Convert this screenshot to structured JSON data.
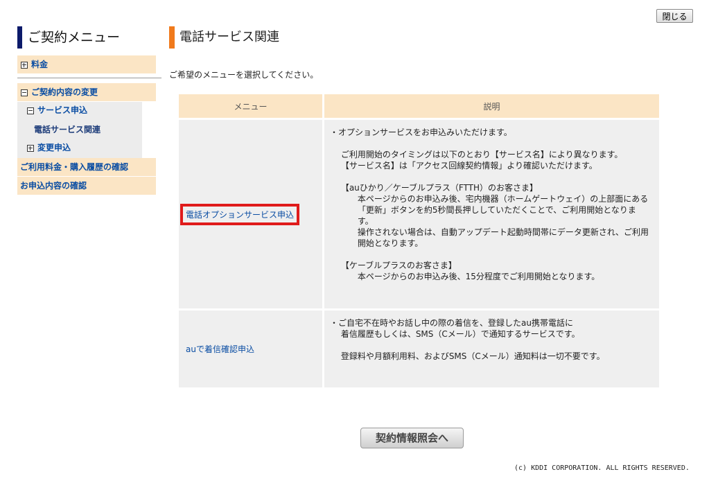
{
  "header": {
    "close_label": "閉じる"
  },
  "sidebar": {
    "title": "ご契約メニュー",
    "items": [
      {
        "label": "料金",
        "icon": "plus"
      },
      {
        "label": "ご契約内容の変更",
        "icon": "minus"
      },
      {
        "label": "サービス申込",
        "icon": "minus"
      },
      {
        "label": "電話サービス関連",
        "icon": "none"
      },
      {
        "label": "変更申込",
        "icon": "plus"
      },
      {
        "label": "ご利用料金・購入履歴の確認",
        "icon": "none"
      },
      {
        "label": "お申込内容の確認",
        "icon": "none"
      }
    ]
  },
  "main": {
    "title": "電話サービス関連",
    "instruction": "ご希望のメニューを選択してください。",
    "table": {
      "headers": [
        "メニュー",
        "説明"
      ],
      "rows": [
        {
          "menu": "電話オプションサービス申込",
          "description": "・オプションサービスをお申込みいただけます。\n\n　 ご利用開始のタイミングは以下のとおり【サービス名】により異なります。\n　 【サービス名】は「アクセス回線契約情報」より確認いただけます。\n\n　 【auひかり／ケーブルプラス（FTTH）のお客さま】\n　　　 本ページからのお申込み後、宅内機器（ホームゲートウェイ）の上部面にある\n　　　 「更新」ボタンを約5秒間長押ししていただくことで、ご利用開始となりま\n　　　 す。\n　　　 操作されない場合は、自動アップデート起動時間帯にデータ更新され、ご利用\n　　　 開始となります。\n\n　 【ケーブルプラスのお客さま】\n　　　 本ページからのお申込み後、15分程度でご利用開始となります。"
        },
        {
          "menu": "auで着信確認申込",
          "description": "・ご自宅不在時やお話し中の際の着信を、登録したau携帯電話に\n　 着信履歴もしくは、SMS（Cメール）で通知するサービスです。\n\n　 登録料や月額利用料、およびSMS（Cメール）通知料は一切不要です。"
        }
      ]
    },
    "back_button": "契約情報照会へ"
  },
  "footer": {
    "copyright": "(c) KDDI CORPORATION. ALL RIGHTS RESERVED."
  },
  "colors": {
    "accent_orange": "#f07a1c",
    "navy": "#0c1a6a",
    "menu_bg": "#fbe5c5",
    "highlight": "#e01b1b",
    "link": "#0a4da3"
  }
}
